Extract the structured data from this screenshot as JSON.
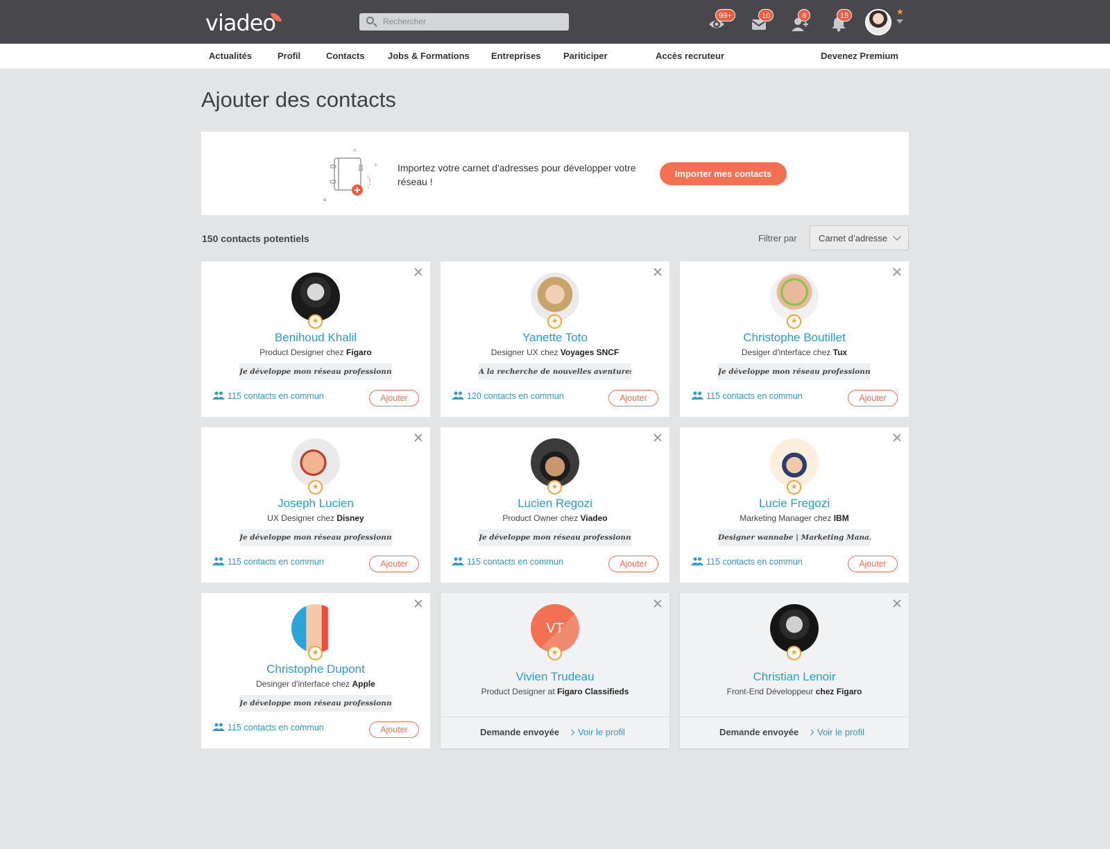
{
  "brand": {
    "logo": "viadeo",
    "accent": "#f37152",
    "link": "#2a9bd1"
  },
  "header": {
    "search_placeholder": "Rechercher",
    "badges": {
      "views": "99+",
      "messages": "10",
      "invitations": "8",
      "notifications": "15"
    }
  },
  "nav": {
    "items": [
      "Actualités",
      "Profil",
      "Contacts",
      "Jobs & Formations",
      "Entreprises",
      "Pariticiper"
    ],
    "recruiter": "Accès recruteur",
    "premium": "Devenez Premium"
  },
  "page": {
    "title": "Ajouter des contacts"
  },
  "import": {
    "text": "Importez votre carnet d'adresses pour développer votre réseau !",
    "button": "Importer mes contacts"
  },
  "list": {
    "count": "150 contacts potentiels",
    "filter_label": "Filtrer par",
    "filter_value": "Carnet d’adresse"
  },
  "cards": [
    {
      "name": "Benihoud Khalil",
      "role": "Product Designer chez",
      "company": "Figaro",
      "tagline": "Je développe mon réseau professionnel",
      "common": "115 contacts en commun",
      "action": "Ajouter"
    },
    {
      "name": "Yanette Toto",
      "role": "Designer UX chez",
      "company": "Voyages SNCF",
      "tagline": "A la recherche de nouvelles aventures..",
      "common": "120 contacts en commun",
      "action": "Ajouter"
    },
    {
      "name": "Christophe Boutillet",
      "role": "Desiger d'interface chez",
      "company": "Tux",
      "tagline": "Je développe mon réseau professionnel",
      "common": "115 contacts en commun",
      "action": "Ajouter"
    },
    {
      "name": "Joseph Lucien",
      "role": "UX Designer chez",
      "company": "Disney",
      "tagline": "Je développe mon réseau professionnel",
      "common": "115 contacts en commun",
      "action": "Ajouter"
    },
    {
      "name": "Lucien Regozi",
      "role": "Product Owner chez",
      "company": "Viadeo",
      "tagline": "Je développe mon réseau professionnel",
      "common": "115 contacts en commun",
      "action": "Ajouter"
    },
    {
      "name": "Lucie Fregozi",
      "role": "Marketing Manager chez",
      "company": "IBM",
      "tagline": "Designer wannabe | Marketing Mana..",
      "common": "115 contacts en commun",
      "action": "Ajouter"
    },
    {
      "name": "Christophe Dupont",
      "role": "Desinger d'interface chez",
      "company": "Apple",
      "tagline": "Je développe mon réseau professionnel",
      "common": "115 contacts en commun",
      "action": "Ajouter"
    },
    {
      "name": "Vivien Trudeau",
      "role": "Product Designer at",
      "company": "Figaro Classifieds",
      "initials": "VT",
      "sent": "Demande envoyée",
      "view": "Voir le profil"
    },
    {
      "name": "Christian Lenoir",
      "role": "Front-End Développeur",
      "company": "chez Figaro",
      "sent": "Demande envoyée",
      "view": "Voir le profil"
    }
  ]
}
